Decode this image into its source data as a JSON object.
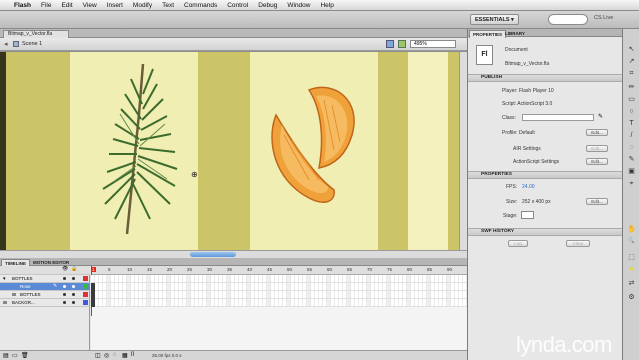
{
  "menubar": {
    "app_name": "Flash",
    "items": [
      "File",
      "Edit",
      "View",
      "Insert",
      "Modify",
      "Text",
      "Commands",
      "Control",
      "Debug",
      "Window",
      "Help"
    ]
  },
  "appbar": {
    "workspace": "ESSENTIALS ▾",
    "cs_live": "CS Live"
  },
  "document": {
    "tab_label": "Bitmap_v_Vector.fla",
    "scene_label": "Scene 1",
    "zoom": "495%"
  },
  "timeline": {
    "tabs": [
      "TIMELINE",
      "MOTION EDITOR"
    ],
    "layers": [
      "BOTTLES",
      "Rose",
      "BOTTLES",
      "BACKGR..."
    ],
    "ruler_ticks": [
      "5",
      "10",
      "15",
      "20",
      "25",
      "30",
      "35",
      "40",
      "45",
      "50",
      "55",
      "60",
      "65",
      "70",
      "75",
      "80",
      "85",
      "90"
    ],
    "current_frame": "1",
    "fps_readout": "25.00 fps   0.0 s"
  },
  "properties_panel": {
    "tabs": [
      "PROPERTIES",
      "LIBRARY"
    ],
    "doc_icon": "Fl",
    "doc_type": "Document",
    "doc_name": "Bitmap_v_Vector.fla",
    "publish_header": "PUBLISH",
    "player": "Player: Flash Player 10",
    "script": "Script: ActionScript 3.0",
    "class_label": "Class:",
    "profile": "Profile: Default",
    "edit_label": "Edit...",
    "air_settings": "AIR Settings",
    "as_settings": "ActionScript Settings",
    "properties_header": "PROPERTIES",
    "fps_label": "FPS:",
    "fps_value": "24.00",
    "size_label": "Size:",
    "size_value": "252 x 400 px",
    "stage_label": "Stage:",
    "swf_history_header": "SWF HISTORY",
    "log_label": "Log",
    "clear_label": "Clear"
  },
  "tools": [
    "↖",
    "↗",
    "⌗",
    "✏",
    "▭",
    "○",
    "T",
    "/",
    "◌",
    "✎",
    "▣",
    "⌖",
    "✋",
    "🔍",
    "⬚",
    "■",
    "⇄",
    "⚙"
  ],
  "watermark": "lynda.com",
  "colors": {
    "stage_band_dark": "#c8c25e",
    "stage_band_light": "#f1eeb3",
    "orange": "#f0a23a",
    "leaf": "#3c6b2e",
    "accent_blue": "#2a6cc8",
    "playhead": "#e22a1a"
  }
}
